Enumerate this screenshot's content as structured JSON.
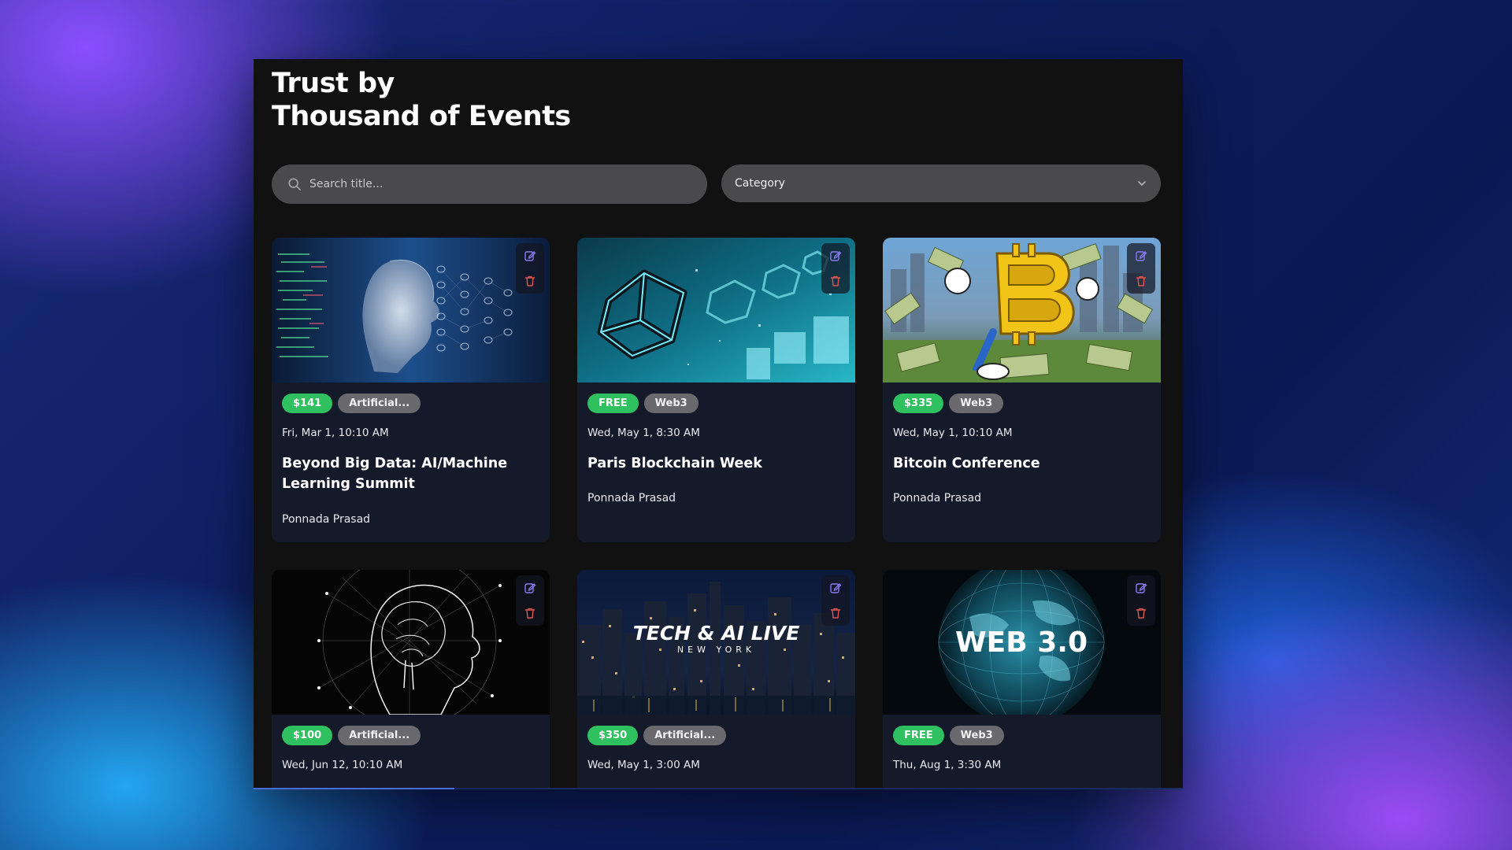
{
  "page": {
    "heading_line1": "Trust by",
    "heading_line2": "Thousand of Events"
  },
  "filters": {
    "search_placeholder": "Search title...",
    "category_label": "Category"
  },
  "colors": {
    "price_badge": "#2fc05f",
    "category_badge": "#6a6a6e",
    "card_background": "#151a2a",
    "edit_icon": "#8b7cf6",
    "delete_icon": "#e0554f"
  },
  "events": [
    {
      "image": "ai-face-neural-network",
      "price": "$141",
      "category": "Artificial...",
      "date": "Fri, Mar 1, 10:10 AM",
      "title": "Beyond Big Data: AI/Machine Learning Summit",
      "organizer": "Ponnada Prasad"
    },
    {
      "image": "blockchain-cubes",
      "price": "FREE",
      "category": "Web3",
      "date": "Wed, May 1, 8:30 AM",
      "title": "Paris Blockchain Week",
      "organizer": "Ponnada Prasad"
    },
    {
      "image": "bitcoin-mascot-money",
      "price": "$335",
      "category": "Web3",
      "date": "Wed, May 1, 10:10 AM",
      "title": "Bitcoin Conference",
      "organizer": "Ponnada Prasad"
    },
    {
      "image": "ai-brain-head",
      "price": "$100",
      "category": "Artificial...",
      "date": "Wed, Jun 12, 10:10 AM"
    },
    {
      "image": "new-york-skyline",
      "image_text_main": "TECH & AI LIVE",
      "image_text_sub": "NEW YORK",
      "price": "$350",
      "category": "Artificial...",
      "date": "Wed, May 1, 3:00 AM"
    },
    {
      "image": "digital-globe",
      "image_text_main": "WEB 3.0",
      "price": "FREE",
      "category": "Web3",
      "date": "Thu, Aug 1, 3:30 AM"
    }
  ],
  "icons": {
    "search": "search-icon",
    "chevron": "chevron-down-icon",
    "edit": "edit-icon",
    "delete": "trash-icon"
  }
}
